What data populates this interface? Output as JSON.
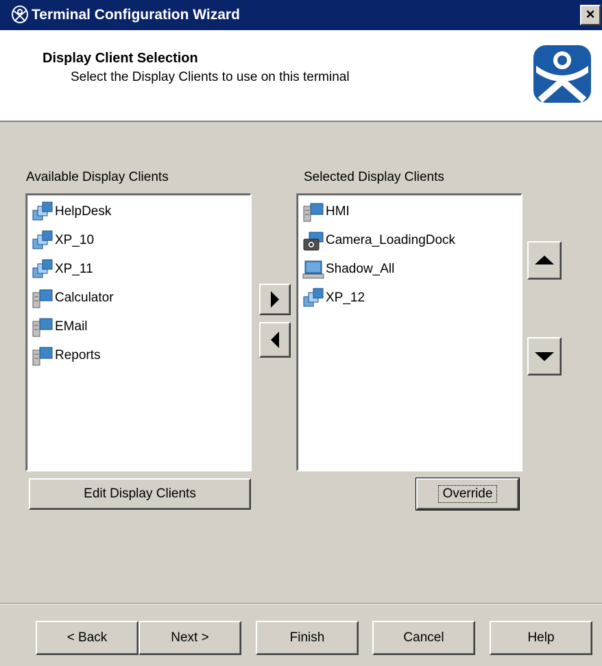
{
  "window": {
    "title": "Terminal Configuration Wizard",
    "close_label": "×"
  },
  "header": {
    "title": "Display Client Selection",
    "subtitle": "Select the Display Clients to use on this terminal"
  },
  "available": {
    "label": "Available Display Clients",
    "items": [
      {
        "label": "HelpDesk",
        "icon": "multi-terminal-icon"
      },
      {
        "label": "XP_10",
        "icon": "multi-terminal-icon"
      },
      {
        "label": "XP_11",
        "icon": "multi-terminal-icon"
      },
      {
        "label": "Calculator",
        "icon": "server-terminal-icon"
      },
      {
        "label": "EMail",
        "icon": "server-terminal-icon"
      },
      {
        "label": "Reports",
        "icon": "server-terminal-icon"
      }
    ],
    "edit_button": "Edit Display Clients"
  },
  "selected": {
    "label": "Selected Display Clients",
    "items": [
      {
        "label": "HMI",
        "icon": "server-terminal-icon"
      },
      {
        "label": "Camera_LoadingDock",
        "icon": "camera-icon"
      },
      {
        "label": "Shadow_All",
        "icon": "laptop-icon"
      },
      {
        "label": "XP_12",
        "icon": "multi-terminal-icon"
      }
    ],
    "override_button": "Override"
  },
  "footer": {
    "back": "< Back",
    "next": "Next >",
    "finish": "Finish",
    "cancel": "Cancel",
    "help": "Help"
  },
  "colors": {
    "titlebar": "#0a246a",
    "face": "#d4d0c8",
    "logo": "#1a5aa6"
  }
}
